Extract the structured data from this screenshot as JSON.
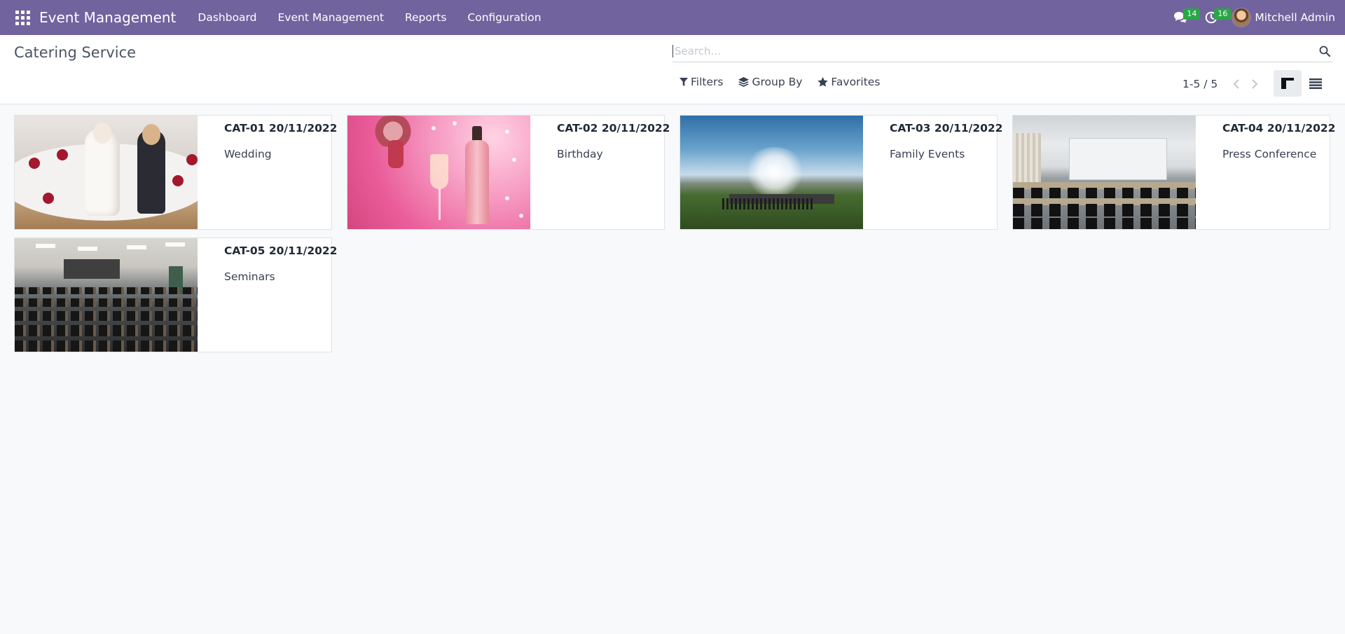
{
  "navbar": {
    "brand": "Event Management",
    "menu": [
      "Dashboard",
      "Event Management",
      "Reports",
      "Configuration"
    ],
    "messages_count": "14",
    "activities_count": "16",
    "user_name": "Mitchell Admin",
    "color": "#71639e"
  },
  "page": {
    "title": "Catering Service"
  },
  "search": {
    "placeholder": "Search...",
    "value": ""
  },
  "filters": {
    "filters_label": "Filters",
    "group_by_label": "Group By",
    "favorites_label": "Favorites"
  },
  "pager": {
    "value": "1-5 / 5"
  },
  "views": {
    "active": "kanban"
  },
  "cards": [
    {
      "ref": "CAT-01 20/11/2022",
      "name": "Wedding"
    },
    {
      "ref": "CAT-02 20/11/2022",
      "name": "Birthday"
    },
    {
      "ref": "CAT-03 20/11/2022",
      "name": "Family Events"
    },
    {
      "ref": "CAT-04 20/11/2022",
      "name": "Press Conference"
    },
    {
      "ref": "CAT-05 20/11/2022",
      "name": "Seminars"
    }
  ]
}
